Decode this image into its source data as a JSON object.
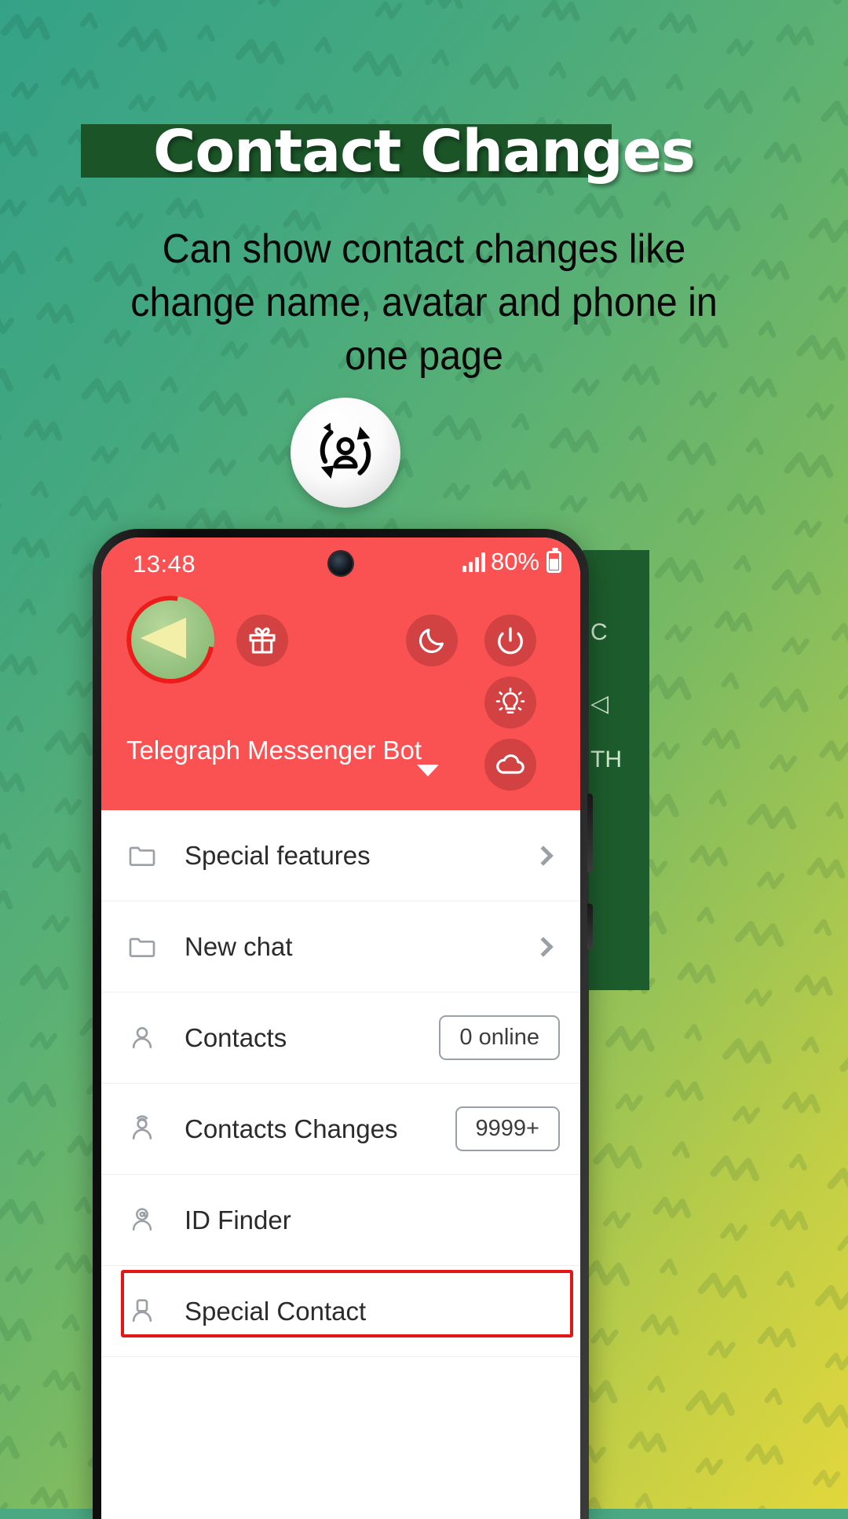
{
  "promo": {
    "title": "Contact Changes",
    "subtitle": "Can show contact changes like change name, avatar and phone in one page",
    "badge_icon": "contact-sync-icon",
    "title_banner_color": "#1a5427",
    "bg_gradient_from": "#35a287",
    "bg_gradient_to": "#e2d73c"
  },
  "phone": {
    "status_bar": {
      "time": "13:48",
      "battery_percent": "80%",
      "signal_icon": "signal-bars-icon",
      "battery_icon": "battery-icon",
      "camera_icon": "front-camera-punchhole"
    },
    "header": {
      "accent_color": "#fa5252",
      "account_name": "Telegraph Messenger Bot",
      "avatar_icon": "telegram-plane-avatar",
      "expand_caret_icon": "caret-down-icon",
      "buttons": [
        {
          "name": "gift-button",
          "icon": "gift-icon"
        },
        {
          "name": "night-mode-button",
          "icon": "moon-icon"
        },
        {
          "name": "power-button",
          "icon": "power-icon"
        },
        {
          "name": "brightness-button",
          "icon": "lightbulb-icon"
        },
        {
          "name": "cloud-button",
          "icon": "cloud-icon"
        }
      ]
    },
    "menu": [
      {
        "label": "Special features",
        "icon": "folder-icon",
        "trailing": "chevron",
        "badge": ""
      },
      {
        "label": "New chat",
        "icon": "folder-icon",
        "trailing": "chevron",
        "badge": ""
      },
      {
        "label": "Contacts",
        "icon": "person-icon",
        "trailing": "badge",
        "badge": "0 online"
      },
      {
        "label": "Contacts Changes",
        "icon": "person-sync-icon",
        "trailing": "badge",
        "badge": "9999+"
      },
      {
        "label": "ID Finder",
        "icon": "person-at-icon",
        "trailing": "none",
        "badge": ""
      },
      {
        "label": "Special Contact",
        "icon": "person-card-icon",
        "trailing": "none",
        "badge": ""
      }
    ],
    "highlight_color": "#e51616"
  },
  "side_panel": {
    "background": "#1d5c2c",
    "rows": [
      "C",
      "◁",
      "TH"
    ]
  }
}
